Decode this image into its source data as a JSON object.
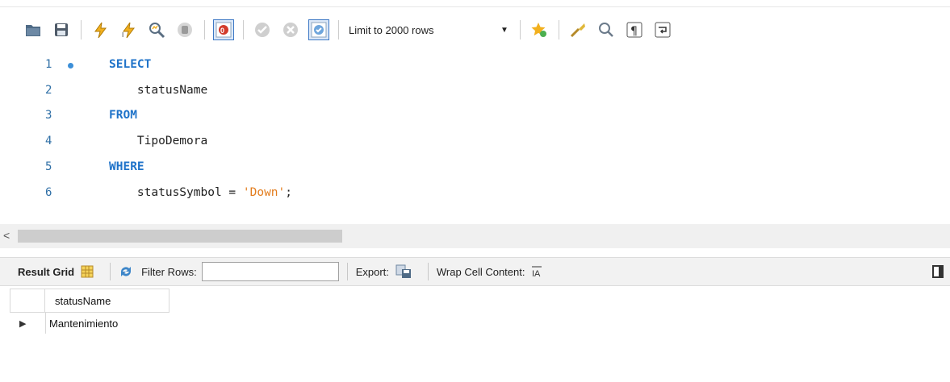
{
  "toolbar": {
    "limit_label": "Limit to 2000 rows",
    "icons": [
      "folder-icon",
      "save-icon",
      "execute-icon",
      "execute-current-icon",
      "explain-icon",
      "stop-icon",
      "toggle-error-icon",
      "commit-icon",
      "rollback-icon",
      "autocommit-icon",
      "bookmark-icon",
      "beautify-icon",
      "find-icon",
      "invisible-chars-icon",
      "wrap-icon"
    ]
  },
  "editor": {
    "lines": [
      {
        "num": "1",
        "tokens": [
          {
            "t": "SELECT",
            "c": "kw"
          }
        ]
      },
      {
        "num": "2",
        "tokens": [
          {
            "t": "    statusName",
            "c": "id"
          }
        ]
      },
      {
        "num": "3",
        "tokens": [
          {
            "t": "FROM",
            "c": "kw"
          }
        ]
      },
      {
        "num": "4",
        "tokens": [
          {
            "t": "    TipoDemora",
            "c": "id"
          }
        ]
      },
      {
        "num": "5",
        "tokens": [
          {
            "t": "WHERE",
            "c": "kw"
          }
        ]
      },
      {
        "num": "6",
        "tokens": [
          {
            "t": "    statusSymbol = ",
            "c": "id"
          },
          {
            "t": "'Down'",
            "c": "str"
          },
          {
            "t": ";",
            "c": "id"
          }
        ]
      }
    ]
  },
  "results": {
    "result_grid_label": "Result Grid",
    "filter_rows_label": "Filter Rows:",
    "filter_value": "",
    "export_label": "Export:",
    "wrap_label": "Wrap Cell Content:",
    "columns": [
      "statusName"
    ],
    "rows": [
      [
        "Mantenimiento"
      ]
    ]
  },
  "colors": {
    "keyword": "#1f73c9",
    "string": "#e37d1e",
    "line_number": "#2f6fa6"
  }
}
